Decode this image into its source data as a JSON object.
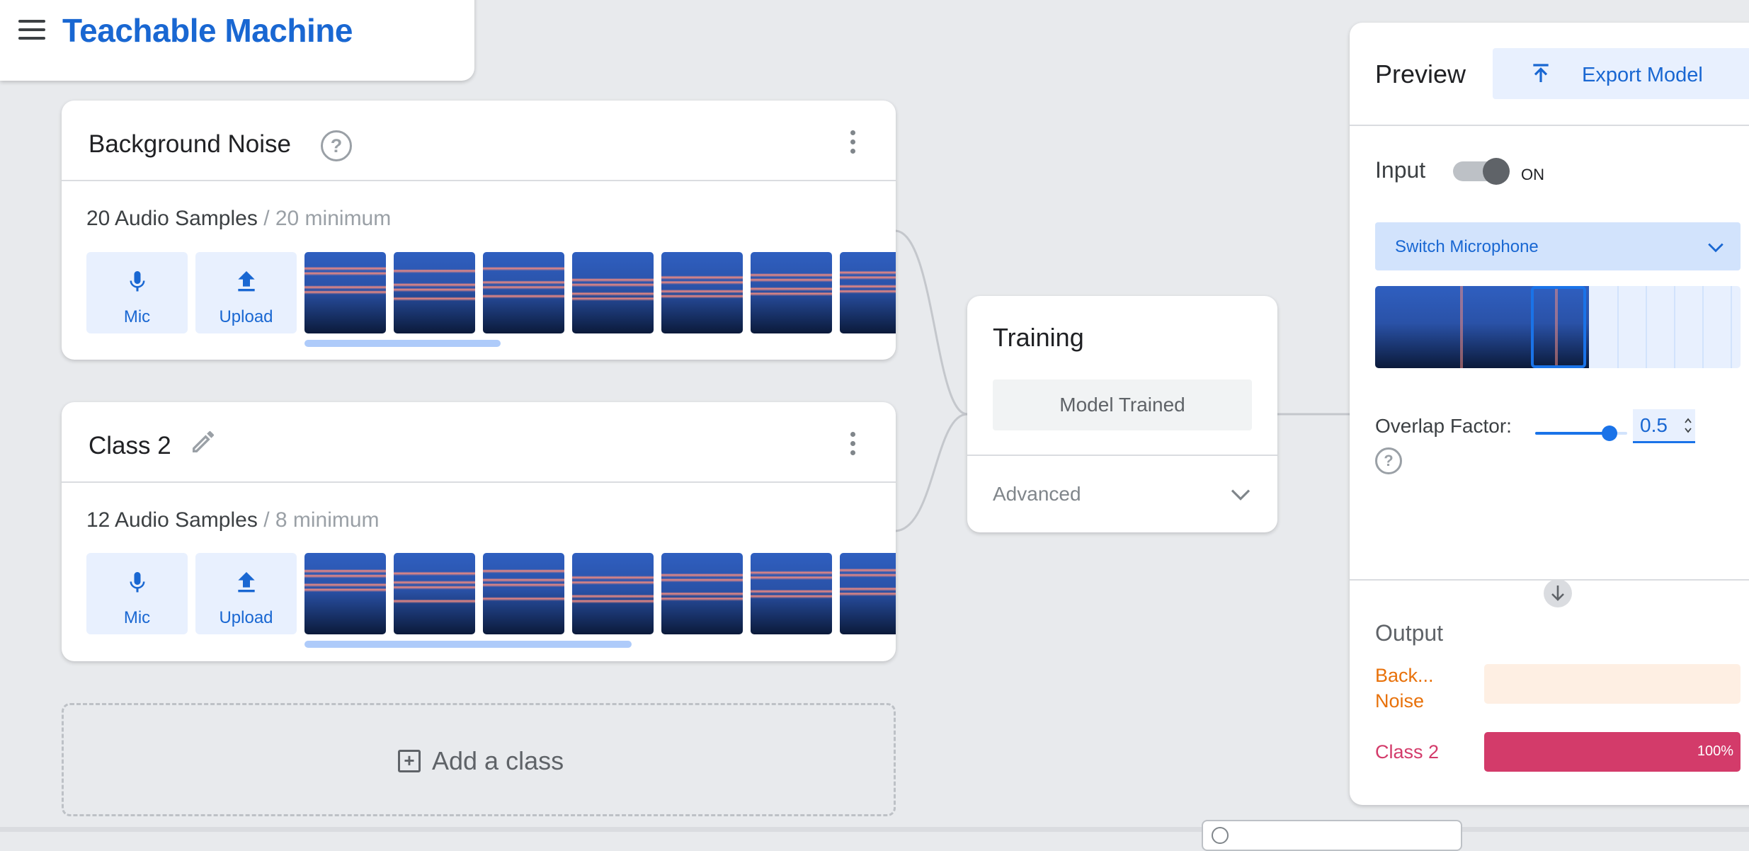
{
  "app": {
    "title": "Teachable Machine"
  },
  "classes": [
    {
      "name": "Background Noise",
      "samples_count": "20 Audio Samples",
      "samples_min": "/ 20 minimum",
      "mic_label": "Mic",
      "upload_label": "Upload",
      "thumbnail_count": 20,
      "scroll_visible_fraction": 0.55
    },
    {
      "name": "Class 2",
      "samples_count": "12 Audio Samples",
      "samples_min": "/ 8 minimum",
      "mic_label": "Mic",
      "upload_label": "Upload",
      "thumbnail_count": 12,
      "scroll_visible_fraction": 0.92
    }
  ],
  "add_class": {
    "label": "Add a class"
  },
  "training": {
    "title": "Training",
    "button_label": "Model Trained",
    "advanced_label": "Advanced"
  },
  "preview": {
    "title": "Preview",
    "export_label": "Export Model",
    "input_label": "Input",
    "input_state": "ON",
    "switch_mic_label": "Switch Microphone",
    "overlap_label": "Overlap Factor:",
    "overlap_value": "0.5",
    "output_label": "Output",
    "outputs": [
      {
        "label": "Back... Noise",
        "confidence": 0.0,
        "color": "#e8710a",
        "track": "#feefe3",
        "pct_text": ""
      },
      {
        "label": "Class 2",
        "confidence": 1.0,
        "color": "#d33b6a",
        "track": "#fce8ee",
        "pct_text": "100%"
      }
    ]
  },
  "colors": {
    "accent": "#1967d2",
    "spectrogram_bg": "#0b1a3a",
    "spectrogram_mid": "#2f5fc0",
    "spectrogram_hot": "#f08a80"
  },
  "icons": [
    "menu-icon",
    "help-icon",
    "pencil-icon",
    "more-vert-icon",
    "mic-icon",
    "upload-icon",
    "export-icon",
    "chevron-down-icon",
    "arrow-down-icon",
    "add-box-icon",
    "globe-icon"
  ]
}
